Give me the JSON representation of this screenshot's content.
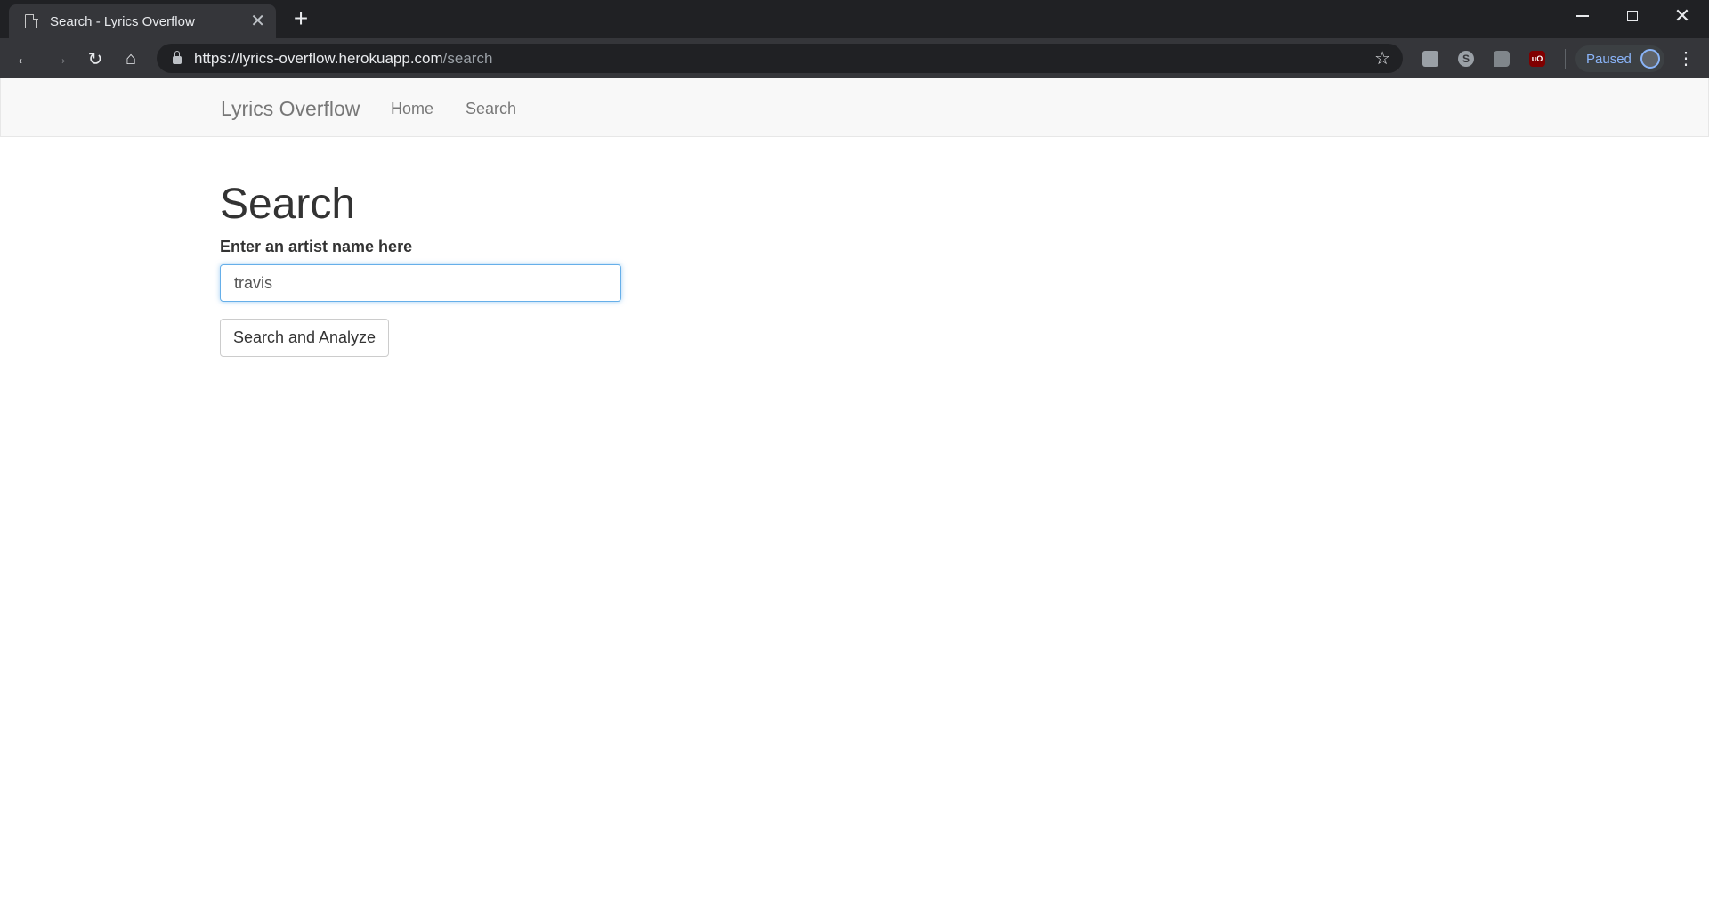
{
  "browser": {
    "tab_title": "Search - Lyrics Overflow",
    "tab_close": "✕",
    "new_tab": "+",
    "url_host": "https://lyrics-overflow.herokuapp.com",
    "url_path": "/search",
    "profile_status": "Paused",
    "extensions": [
      "chat-icon",
      "skype-icon",
      "comment-icon",
      "ublock-icon"
    ],
    "ublock_label": "uO"
  },
  "navbar": {
    "brand": "Lyrics Overflow",
    "links": [
      "Home",
      "Search"
    ]
  },
  "main": {
    "heading": "Search",
    "field_label": "Enter an artist name here",
    "input_value": "travis",
    "submit_label": "Search and Analyze"
  },
  "colors": {
    "navbar_bg": "#f8f8f8",
    "focus_border": "#66afe9",
    "text": "#333333",
    "nav_text": "#777777"
  }
}
